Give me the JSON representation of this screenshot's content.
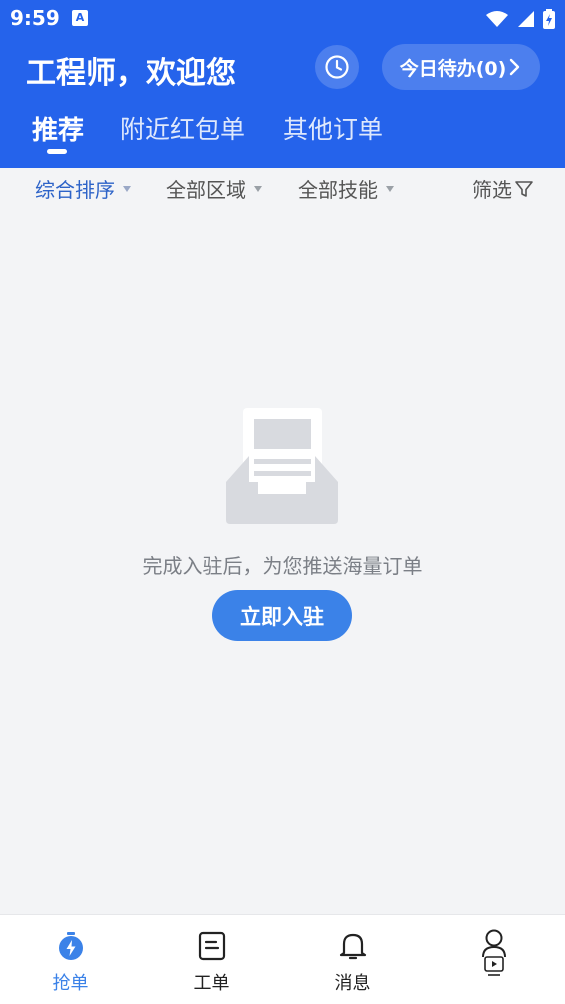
{
  "status_bar": {
    "time": "9:59",
    "app_icon_letter": "A"
  },
  "header": {
    "greeting": "工程师，欢迎您",
    "todo_label": "今日待办(0)",
    "tabs": [
      {
        "label": "推荐",
        "active": true
      },
      {
        "label": "附近红包单",
        "active": false
      },
      {
        "label": "其他订单",
        "active": false
      }
    ]
  },
  "filters": {
    "sort": "综合排序",
    "area": "全部区域",
    "skill": "全部技能",
    "filter": "筛选"
  },
  "empty_state": {
    "message": "完成入驻后，为您推送海量订单",
    "button": "立即入驻"
  },
  "bottom_nav": [
    {
      "label": "抢单",
      "icon": "grab-order-icon",
      "active": true
    },
    {
      "label": "工单",
      "icon": "work-order-icon",
      "active": false
    },
    {
      "label": "消息",
      "icon": "bell-icon",
      "active": false
    },
    {
      "label": "",
      "icon": "profile-icon",
      "active": false
    }
  ],
  "colors": {
    "primary": "#2563eb",
    "button": "#3b82e8",
    "background": "#f3f4f6"
  }
}
